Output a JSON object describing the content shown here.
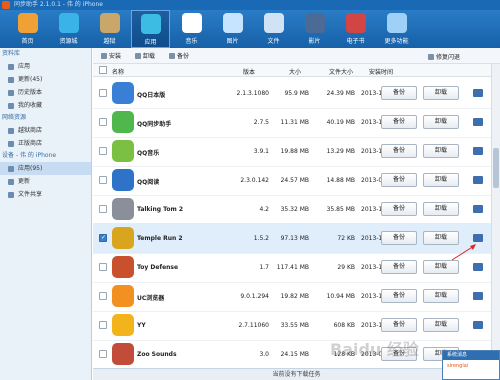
{
  "titlebar": {
    "title": "同步助手 2.1.0.1 - 伟 的 iPhone"
  },
  "toolbar": {
    "items": [
      {
        "label": "首页",
        "icon": "home-icon"
      },
      {
        "label": "资源城",
        "icon": "store-icon"
      },
      {
        "label": "越狱",
        "icon": "jailbreak-icon"
      },
      {
        "label": "应用",
        "icon": "apps-icon"
      },
      {
        "label": "音乐",
        "icon": "music-icon"
      },
      {
        "label": "图片",
        "icon": "photo-icon"
      },
      {
        "label": "文件",
        "icon": "file-icon"
      },
      {
        "label": "影片",
        "icon": "movie-icon"
      },
      {
        "label": "电子书",
        "icon": "ebook-icon"
      },
      {
        "label": "更多功能",
        "icon": "more-icon"
      }
    ]
  },
  "sidebar": {
    "sec1": "资料库",
    "lib_items": [
      {
        "label": "应用"
      },
      {
        "label": "更新(45)"
      },
      {
        "label": "历史版本"
      },
      {
        "label": "我的收藏"
      }
    ],
    "sec2": "网络资源",
    "net_items": [
      {
        "label": "越狱商店"
      },
      {
        "label": "正版商店"
      }
    ],
    "sec3": "设备 - 伟 的 iPhone",
    "dev_items": [
      {
        "label": "应用(95)"
      },
      {
        "label": "更新"
      },
      {
        "label": "文件共享"
      }
    ]
  },
  "content_toolbar": {
    "install": "安装",
    "uninstall": "卸载",
    "backup": "备份",
    "repair": "修复闪退"
  },
  "table": {
    "headers": {
      "name": "名称",
      "version": "版本",
      "size": "大小",
      "file_size": "文件大小",
      "install_time": "安装时间"
    },
    "backup_label": "备份",
    "uninstall_label": "卸载",
    "rows": [
      {
        "name": "QQ日本版",
        "version": "2.1.3.1080",
        "size": "95.9 MB",
        "file_size": "24.39 MB",
        "date": "2013-11-01",
        "color": "#3a7fd6",
        "checked": false
      },
      {
        "name": "QQ同步助手",
        "version": "2.7.5",
        "size": "11.31 MB",
        "file_size": "40.19 MB",
        "date": "2013-11-10",
        "color": "#4fb74b",
        "checked": false
      },
      {
        "name": "QQ音乐",
        "version": "3.9.1",
        "size": "19.88 MB",
        "file_size": "13.29 MB",
        "date": "2013-12-04",
        "color": "#7bc043",
        "checked": false
      },
      {
        "name": "QQ阅读",
        "version": "2.3.0.142",
        "size": "24.57 MB",
        "file_size": "14.88 MB",
        "date": "2013-08-16",
        "color": "#2f73c8",
        "checked": false
      },
      {
        "name": "Talking Tom 2",
        "version": "4.2",
        "size": "35.32 MB",
        "file_size": "35.85 MB",
        "date": "2013-11-17",
        "color": "#8a8f99",
        "checked": false
      },
      {
        "name": "Temple Run 2",
        "version": "1.5.2",
        "size": "97.13 MB",
        "file_size": "72 KB",
        "date": "2013-11-10",
        "color": "#d9a51f",
        "checked": true
      },
      {
        "name": "Toy Defense",
        "version": "1.7",
        "size": "117.41 MB",
        "file_size": "29 KB",
        "date": "2013-10-26",
        "color": "#c8502d",
        "checked": false
      },
      {
        "name": "UC浏览器",
        "version": "9.0.1.294",
        "size": "19.82 MB",
        "file_size": "10.94 MB",
        "date": "2013-12-03",
        "color": "#f29121",
        "checked": false
      },
      {
        "name": "YY",
        "version": "2.7.11060",
        "size": "33.55 MB",
        "file_size": "608 KB",
        "date": "2013-11-28",
        "color": "#f3b41b",
        "checked": false
      },
      {
        "name": "Zoo Sounds",
        "version": "3.0",
        "size": "24.15 MB",
        "file_size": "128 KB",
        "date": "2013-08-16",
        "color": "#c24b3a",
        "checked": false
      }
    ]
  },
  "status": {
    "text": "当前没有下载任务"
  },
  "notification": {
    "title": "系统消息",
    "body": "sirenglai"
  },
  "watermark": "Baidu 经验"
}
